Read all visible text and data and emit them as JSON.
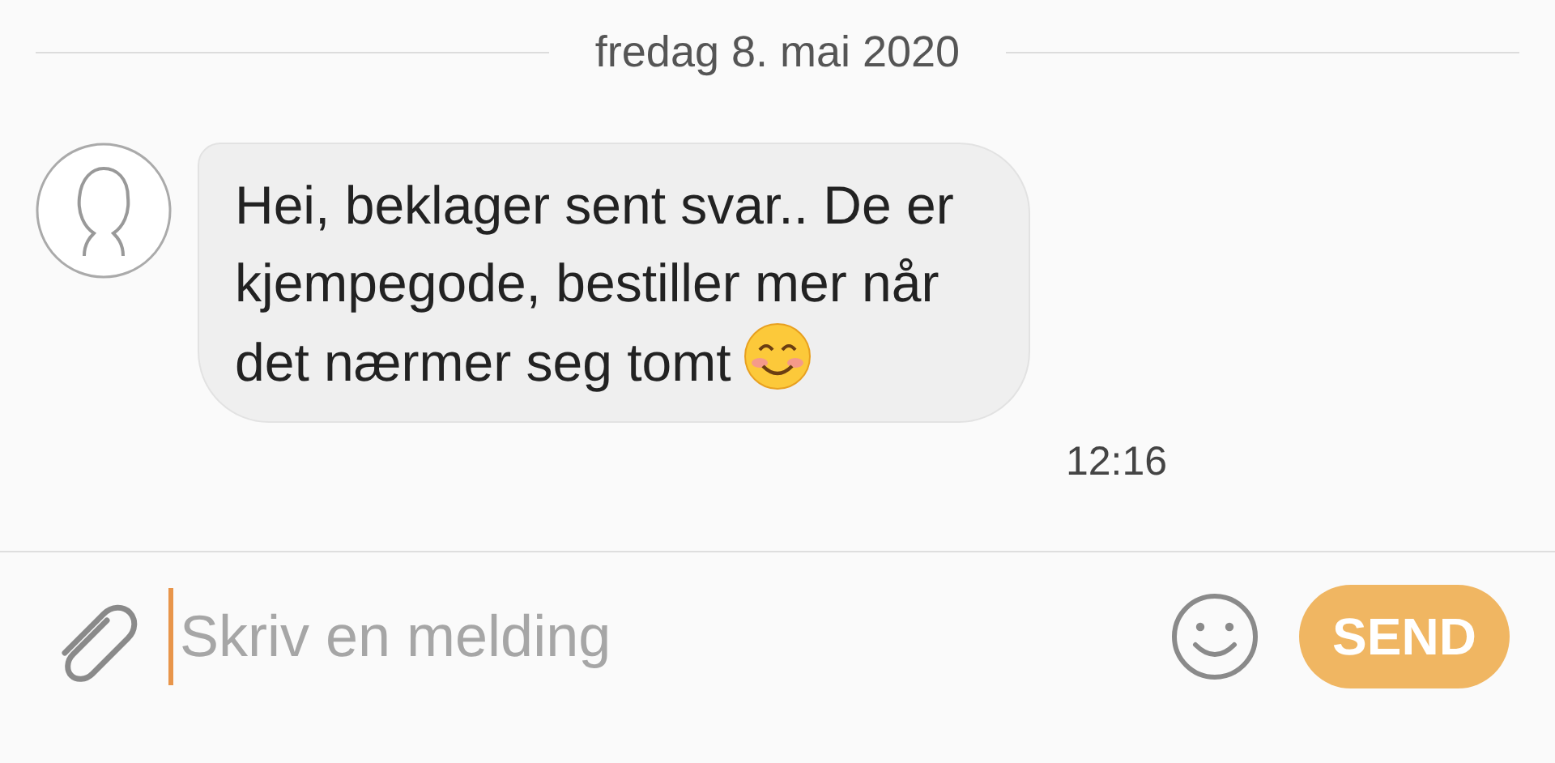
{
  "date_divider": "fredag 8. mai 2020",
  "messages": [
    {
      "text": "Hei, beklager sent svar.. De er kjempegode, bestiller mer når det nærmer seg tomt",
      "time": "12:16"
    }
  ],
  "composer": {
    "placeholder": "Skriv en melding",
    "send": {
      "label": "SEND",
      "disabled": true
    }
  }
}
